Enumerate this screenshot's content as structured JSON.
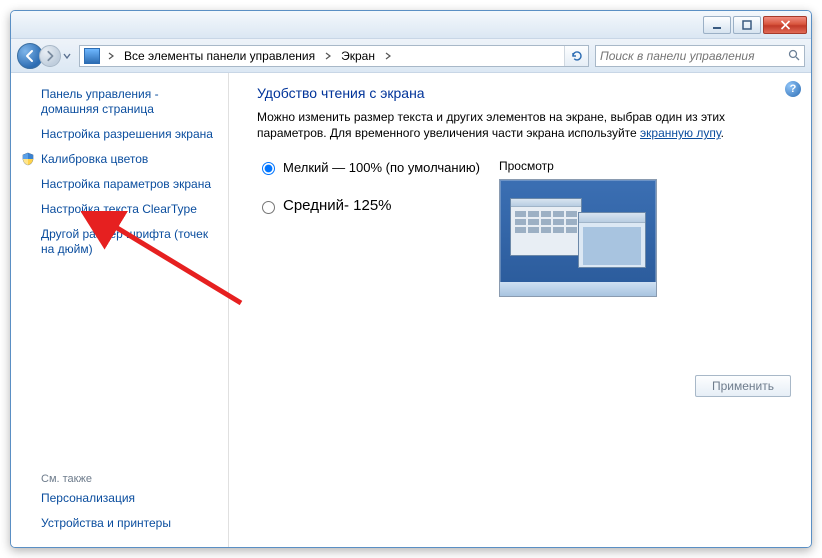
{
  "breadcrumb": {
    "seg1": "Все элементы панели управления",
    "seg2": "Экран"
  },
  "search": {
    "placeholder": "Поиск в панели управления"
  },
  "sidebar": {
    "home": "Панель управления - домашняя страница",
    "resolution": "Настройка разрешения экрана",
    "calibration": "Калибровка цветов",
    "params": "Настройка параметров экрана",
    "cleartype": "Настройка текста ClearType",
    "dpi": "Другой размер шрифта (точек на дюйм)",
    "seealso": "См. также",
    "personalization": "Персонализация",
    "devices": "Устройства и принтеры"
  },
  "content": {
    "heading": "Удобство чтения с экрана",
    "desc1": "Можно изменить размер текста и других элементов на экране, выбрав один из этих параметров. Для временного увеличения части экрана используйте ",
    "link": "экранную лупу",
    "desc2": ".",
    "opt_small": "Мелкий — 100% (по умолчанию)",
    "opt_medium": "Средний- 125%",
    "preview_label": "Просмотр",
    "apply": "Применить"
  }
}
